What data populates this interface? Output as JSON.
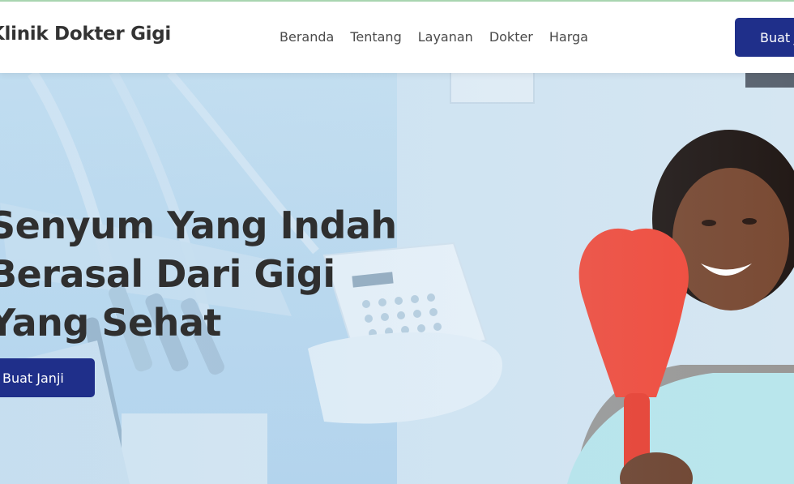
{
  "navbar": {
    "brand": "Klinik Dokter Gigi",
    "links": [
      "Beranda",
      "Tentang",
      "Layanan",
      "Dokter",
      "Harga"
    ],
    "cta_label": "Buat Janji"
  },
  "hero": {
    "title_lines": [
      "Senyum Yang Indah",
      "Berasal Dari Gigi",
      "Yang Sehat"
    ],
    "button_label": "Buat Janji"
  },
  "colors": {
    "primary": "#1f2f8a",
    "hero_bg": "#bcd9ee",
    "mirror": "#f24a3a"
  }
}
